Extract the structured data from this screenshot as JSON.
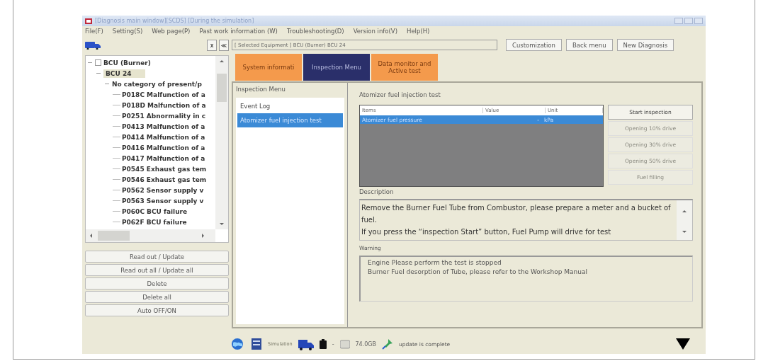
{
  "window": {
    "title": "[Diagnosis main window][SCDS] [During the simulation]"
  },
  "menu": [
    "File(F)",
    "Setting(S)",
    "Web page(P)",
    "Past work information (W)",
    "Troubleshooting(D)",
    "Version info(V)",
    "Help(H)"
  ],
  "sidebar": {
    "close_label": "x",
    "collapse_label": "≪",
    "tree": [
      {
        "label": "BCU (Burner)",
        "checked": false,
        "expanded": true,
        "selected": false,
        "children": [
          {
            "label": "BCU 24",
            "expanded": true,
            "selected": true,
            "children": [
              {
                "label": "No category of present/p",
                "expanded": true,
                "selected": false,
                "children": [
                  {
                    "label": "P018C Malfunction of a"
                  },
                  {
                    "label": "P018D Malfunction of a"
                  },
                  {
                    "label": "P0251 Abnormality in c"
                  },
                  {
                    "label": "P0413 Malfunction of a"
                  },
                  {
                    "label": "P0414 Malfunction of a"
                  },
                  {
                    "label": "P0416 Malfunction of a"
                  },
                  {
                    "label": "P0417 Malfunction of a"
                  },
                  {
                    "label": "P0545 Exhaust gas tem"
                  },
                  {
                    "label": "P0546 Exhaust gas tem"
                  },
                  {
                    "label": "P0562 Sensor supply v"
                  },
                  {
                    "label": "P0563 Sensor supply v"
                  },
                  {
                    "label": "P060C BCU failure"
                  },
                  {
                    "label": "P062F BCU failure"
                  }
                ]
              }
            ]
          }
        ]
      }
    ],
    "buttons": [
      "Read out / Update",
      "Read out all / Update all",
      "Delete",
      "Delete all",
      "Auto OFF/ON"
    ]
  },
  "header": {
    "selected_equipment": "[ Selected Equipment ] BCU (Burner) BCU 24",
    "buttons": [
      "Customization",
      "Back menu",
      "New Diagnosis"
    ]
  },
  "tabs": [
    {
      "label": "System informati",
      "selected": false
    },
    {
      "label": "Inspection Menu",
      "selected": true
    },
    {
      "label": "Data monitor and Active test",
      "selected": false
    }
  ],
  "inspection_menu": {
    "title": "Inspection Menu",
    "items": [
      {
        "label": "Event Log",
        "selected": false
      },
      {
        "label": "Atomizer fuel injection test",
        "selected": true
      }
    ]
  },
  "test": {
    "title": "Atomizer fuel injection test",
    "table": {
      "columns": [
        "Items",
        "Value",
        "Unit"
      ],
      "rows": [
        {
          "cells": [
            "Atomizer fuel pressure",
            "-",
            "kPa"
          ],
          "selected": true
        }
      ]
    },
    "actions": [
      {
        "label": "Start inspection",
        "disabled": false
      },
      {
        "label": "Opening 10% drive",
        "disabled": true
      },
      {
        "label": "Opening 30% drive",
        "disabled": true
      },
      {
        "label": "Opening 50% drive",
        "disabled": true
      },
      {
        "label": "Fuel filling",
        "disabled": true
      }
    ],
    "description_label": "Description",
    "description": [
      "Remove the Burner Fuel Tube from Combustor, please prepare a meter and a bucket of fuel.",
      "If you press the “inspection Start” button, Fuel Pump will drive for test"
    ],
    "warning_label": "Warning",
    "warning": [
      "Engine Please perform the test is stopped",
      "Burner Fuel desorption of Tube, please refer to the Workshop Manual"
    ]
  },
  "status_bar": {
    "simulation_label": "Simulation",
    "battery_reading": "-",
    "disk": "74.0GB",
    "message": "update is complete"
  }
}
